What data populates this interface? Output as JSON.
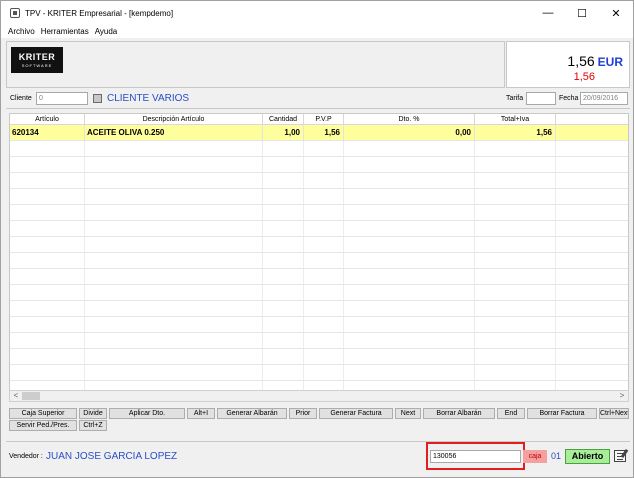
{
  "window": {
    "title": "TPV - KRITER Empresarial -  [kempdemo]",
    "minimize": "—",
    "maximize": "☐",
    "close": "✕"
  },
  "menu": [
    "Archivo",
    "Herramientas",
    "Ayuda"
  ],
  "logo": {
    "main": "KRITER",
    "sub": "SOFTWARE"
  },
  "totals": {
    "amount": "1,56",
    "currency": "EUR",
    "secondary": "1,56"
  },
  "client": {
    "label": "Cliente",
    "code": "0",
    "name": "CLIENTE VARIOS",
    "tarifa_label": "Tarifa",
    "tarifa_value": "",
    "fecha_label": "Fecha",
    "fecha_value": "20/09/2016"
  },
  "grid": {
    "columns": [
      "Artículo",
      "Descripción Artículo",
      "Cantidad",
      "P.V.P",
      "Dto. %",
      "Total+Iva"
    ],
    "rows": [
      {
        "articulo": "620134",
        "descripcion": "ACEITE OLIVA 0.250",
        "cantidad": "1,00",
        "pvp": "1,56",
        "dto": "0,00",
        "total": "1,56"
      }
    ]
  },
  "scrollbar": {
    "left": "<",
    "right": ">"
  },
  "buttons_row1": [
    "Caja Superior",
    "Divide",
    "Aplicar Dto.",
    "Alt+I",
    "Generar Albarán",
    "Prior",
    "Generar Factura",
    "Next",
    "Borrar Albarán",
    "End",
    "Borrar Factura",
    "Ctrl+Next"
  ],
  "buttons_row2": [
    "Servir Ped./Pres.",
    "Ctrl+Z"
  ],
  "footer": {
    "vendor_label": "Vendedor :",
    "vendor_name": "JUAN JOSE GARCIA LOPEZ",
    "code_value": "130056",
    "caja_label": "caja",
    "caja_number": "01",
    "status": "Abierto"
  },
  "colors": {
    "selected_row": "#fffe9c",
    "link_blue": "#2a4ec6",
    "total_red": "#e00000",
    "status_green": "#a8ee9a",
    "highlight": "#e02020"
  }
}
